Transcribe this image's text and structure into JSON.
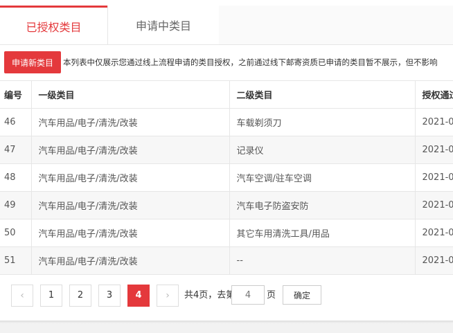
{
  "tabs": {
    "authorized": "已授权类目",
    "applying": "申请中类目"
  },
  "toolbar": {
    "apply_button": "申请新类目",
    "notice": "本列表中仅展示您通过线上流程申请的类目授权，之前通过线下邮寄资质已申请的类目暂不展示，但不影响"
  },
  "table": {
    "headers": [
      "编号",
      "一级类目",
      "二级类目",
      "授权通过"
    ],
    "rows": [
      [
        "46",
        "汽车用品/电子/清洗/改装",
        "车载剃须刀",
        "2021-0"
      ],
      [
        "47",
        "汽车用品/电子/清洗/改装",
        "记录仪",
        "2021-0"
      ],
      [
        "48",
        "汽车用品/电子/清洗/改装",
        "汽车空调/驻车空调",
        "2021-0"
      ],
      [
        "49",
        "汽车用品/电子/清洗/改装",
        "汽车电子防盗安防",
        "2021-0"
      ],
      [
        "50",
        "汽车用品/电子/清洗/改装",
        "其它车用清洗工具/用品",
        "2021-0"
      ],
      [
        "51",
        "汽车用品/电子/清洗/改装",
        "--",
        "2021-0"
      ]
    ]
  },
  "pagination": {
    "prev": "‹",
    "next": "›",
    "pages": [
      "1",
      "2",
      "3",
      "4"
    ],
    "current_page": "4",
    "total_text": "共4页，去第",
    "page_suffix": "页",
    "goto_placeholder": "4",
    "confirm": "确定"
  },
  "colors": {
    "accent": "#e4393c"
  }
}
